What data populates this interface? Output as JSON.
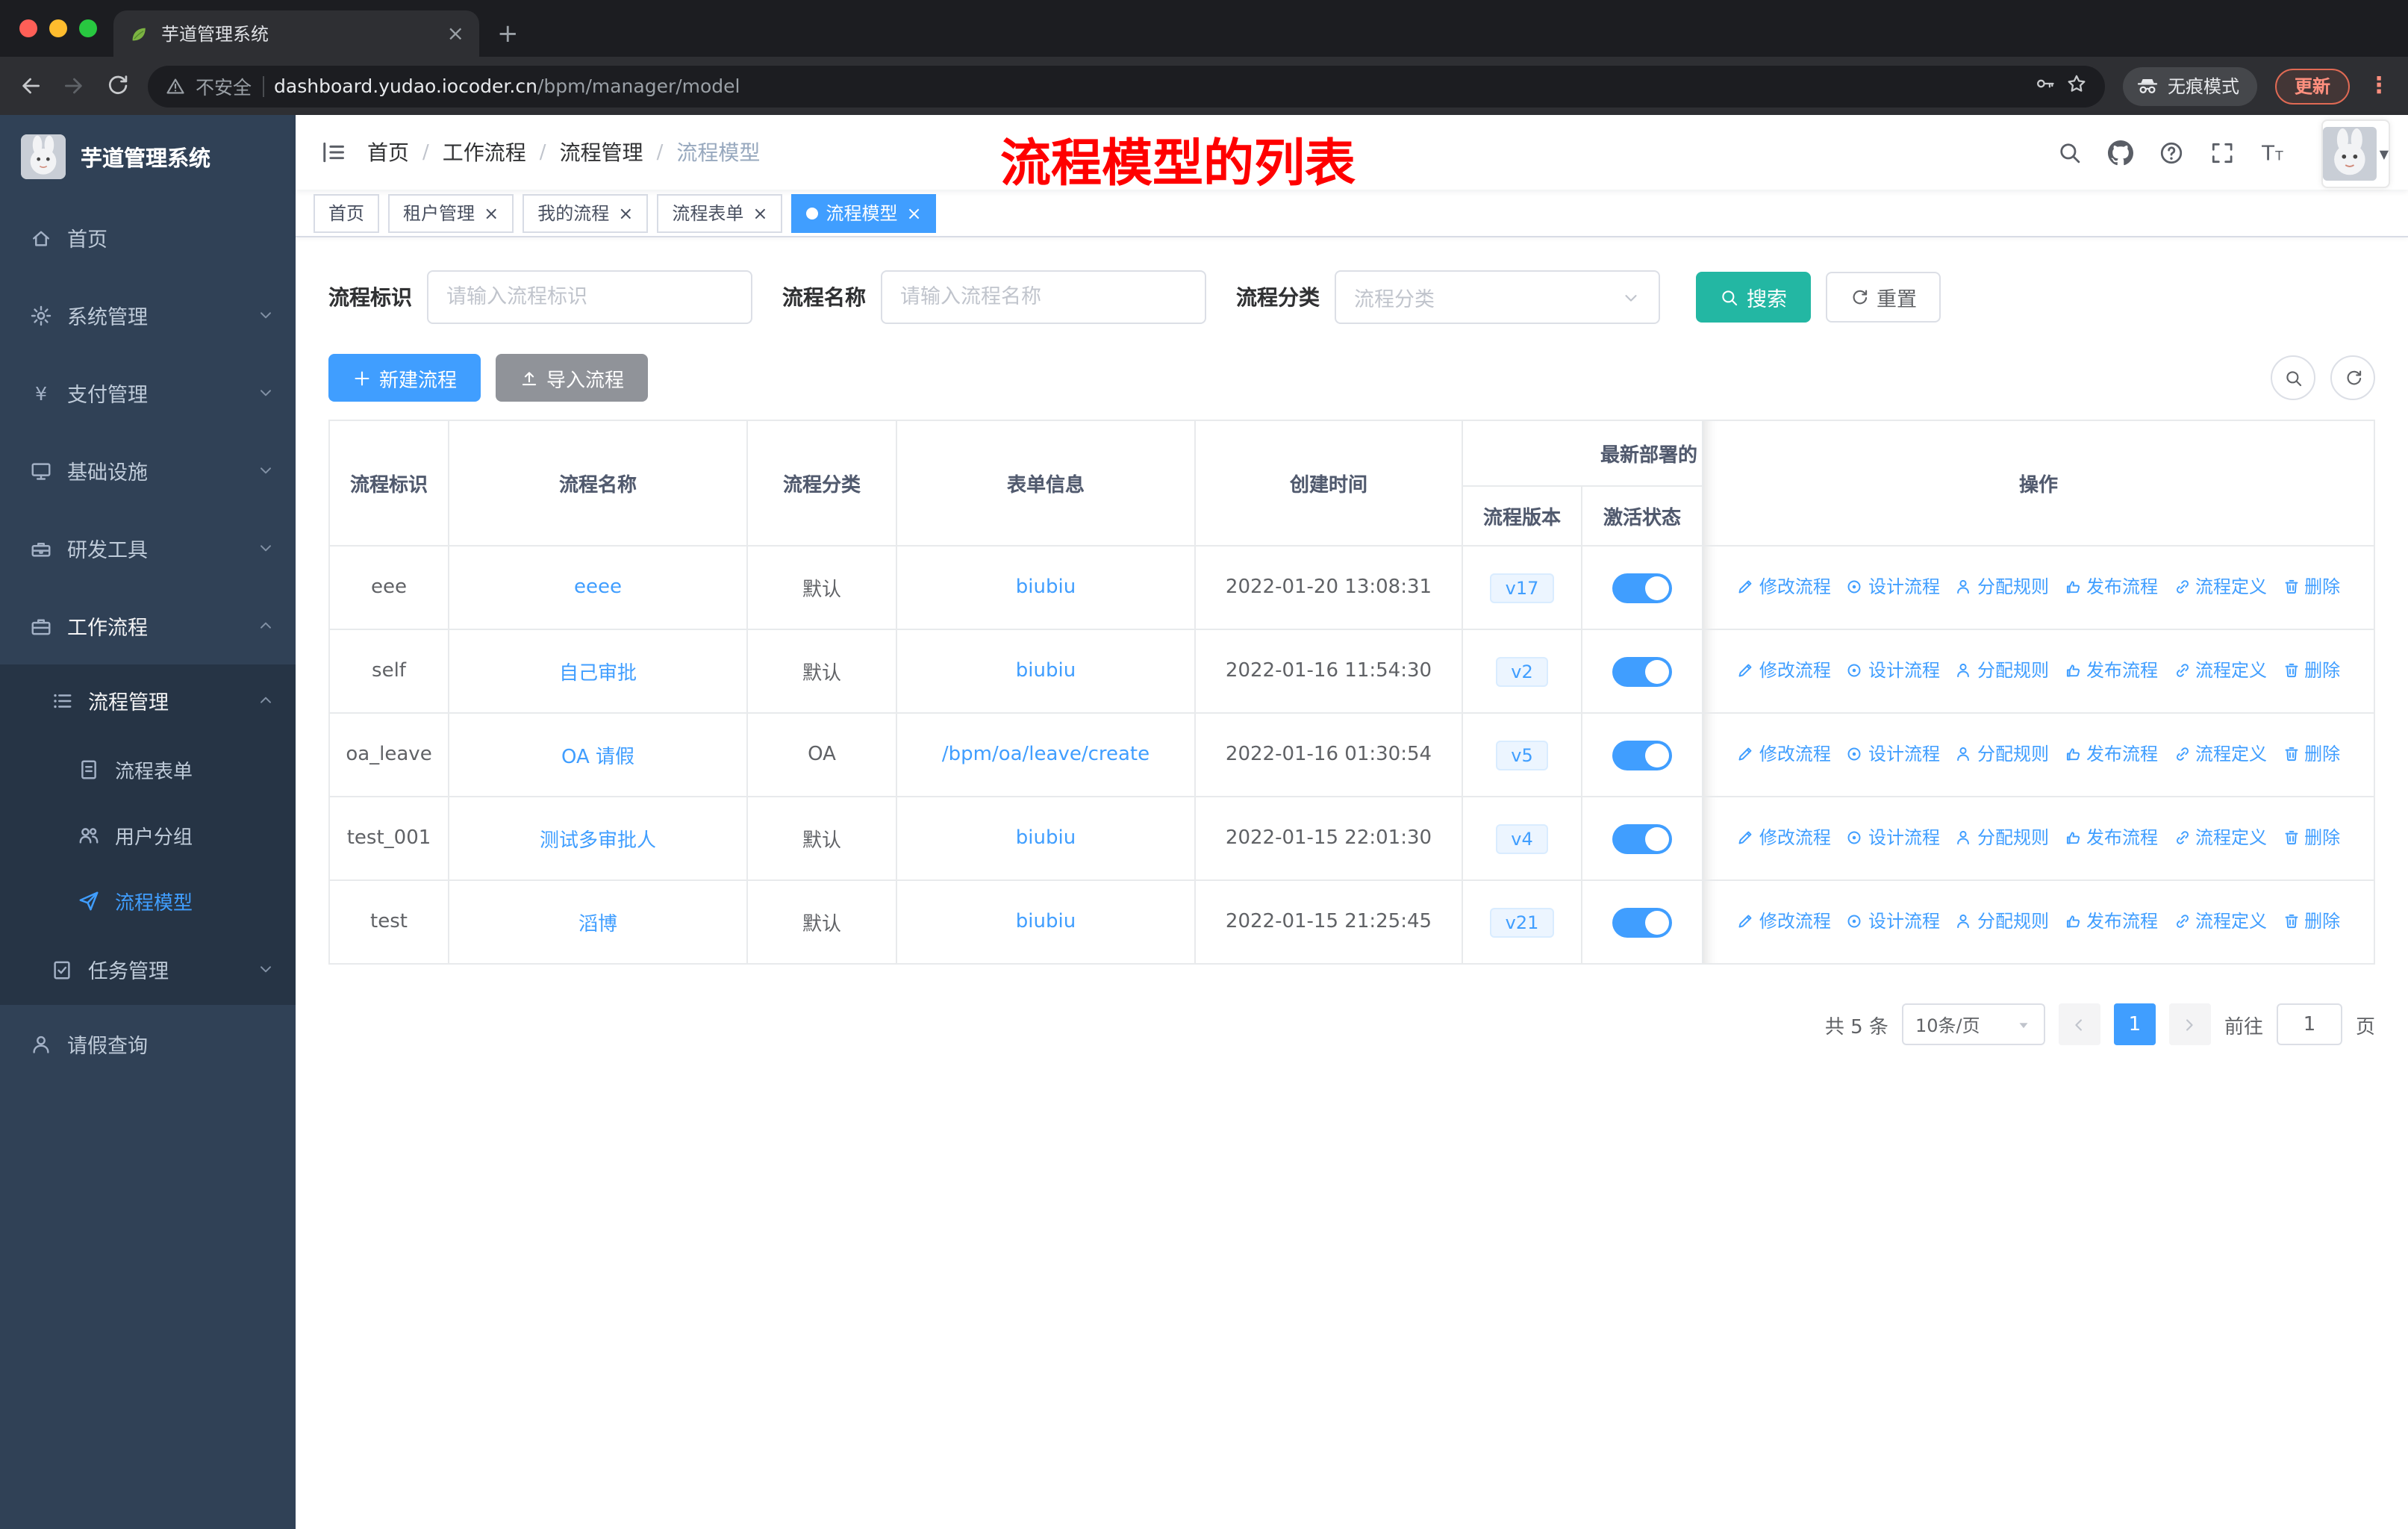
{
  "colors": {
    "accent_blue": "#409eff",
    "search_button_teal": "#23b7a3",
    "annotation_red": "#ff0000",
    "sidebar_bg": "#304156",
    "tag_active_blue": "#409eff"
  },
  "browser": {
    "tab_title": "芋道管理系统",
    "security_label": "不安全",
    "url_host": "dashboard.yudao.iocoder.cn",
    "url_path": "/bpm/manager/model",
    "incognito_label": "无痕模式",
    "update_label": "更新"
  },
  "sidebar": {
    "logo_title": "芋道管理系统",
    "items": [
      {
        "key": "home",
        "label": "首页",
        "icon": "home-icon",
        "level": 1
      },
      {
        "key": "system",
        "label": "系统管理",
        "icon": "gear-icon",
        "level": 1,
        "chevron": "down"
      },
      {
        "key": "payment",
        "label": "支付管理",
        "icon": "yen-icon",
        "level": 1,
        "chevron": "down"
      },
      {
        "key": "infrastructure",
        "label": "基础设施",
        "icon": "infra-icon",
        "level": 1,
        "chevron": "down"
      },
      {
        "key": "devtools",
        "label": "研发工具",
        "icon": "tools-icon",
        "level": 1,
        "chevron": "down"
      },
      {
        "key": "workflow",
        "label": "工作流程",
        "icon": "workflow-icon",
        "level": 1,
        "chevron": "up",
        "open": true
      },
      {
        "key": "process-manage",
        "label": "流程管理",
        "icon": "process-list-icon",
        "level": 2,
        "chevron": "up",
        "open": true
      },
      {
        "key": "process-form",
        "label": "流程表单",
        "icon": "form-icon",
        "level": 3
      },
      {
        "key": "user-group",
        "label": "用户分组",
        "icon": "users-icon",
        "level": 3
      },
      {
        "key": "process-model",
        "label": "流程模型",
        "icon": "send-icon",
        "level": 3,
        "active": true
      },
      {
        "key": "task-manage",
        "label": "任务管理",
        "icon": "task-icon",
        "level": 2,
        "chevron": "down"
      },
      {
        "key": "leave-query",
        "label": "请假查询",
        "icon": "user-icon",
        "level": 1
      }
    ]
  },
  "navbar": {
    "breadcrumb": [
      "首页",
      "工作流程",
      "流程管理",
      "流程模型"
    ],
    "annotation": "流程模型的列表"
  },
  "tags": [
    {
      "label": "首页",
      "closable": false,
      "active": false
    },
    {
      "label": "租户管理",
      "closable": true,
      "active": false
    },
    {
      "label": "我的流程",
      "closable": true,
      "active": false
    },
    {
      "label": "流程表单",
      "closable": true,
      "active": false
    },
    {
      "label": "流程模型",
      "closable": true,
      "active": true
    }
  ],
  "filters": {
    "id_label": "流程标识",
    "id_placeholder": "请输入流程标识",
    "name_label": "流程名称",
    "name_placeholder": "请输入流程名称",
    "category_label": "流程分类",
    "category_placeholder": "流程分类",
    "search_label": "搜索",
    "reset_label": "重置"
  },
  "toolbar": {
    "create_label": "新建流程",
    "import_label": "导入流程"
  },
  "table": {
    "headers": {
      "id": "流程标识",
      "name": "流程名称",
      "category": "流程分类",
      "form": "表单信息",
      "created": "创建时间",
      "deploy_group": "最新部署的",
      "version": "流程版本",
      "status": "激活状态",
      "ops": "操作"
    },
    "rows": [
      {
        "id": "eee",
        "name": "eeee",
        "category": "默认",
        "form": "biubiu",
        "created": "2022-01-20 13:08:31",
        "version": "v17",
        "active": true
      },
      {
        "id": "self",
        "name": "自己审批",
        "category": "默认",
        "form": "biubiu",
        "created": "2022-01-16 11:54:30",
        "version": "v2",
        "active": true
      },
      {
        "id": "oa_leave",
        "name": "OA 请假",
        "category": "OA",
        "form": "/bpm/oa/leave/create",
        "created": "2022-01-16 01:30:54",
        "version": "v5",
        "active": true
      },
      {
        "id": "test_001",
        "name": "测试多审批人",
        "category": "默认",
        "form": "biubiu",
        "created": "2022-01-15 22:01:30",
        "version": "v4",
        "active": true
      },
      {
        "id": "test",
        "name": "滔博",
        "category": "默认",
        "form": "biubiu",
        "created": "2022-01-15 21:25:45",
        "version": "v21",
        "active": true
      }
    ],
    "ops": [
      {
        "key": "edit",
        "label": "修改流程",
        "icon": "edit-icon"
      },
      {
        "key": "design",
        "label": "设计流程",
        "icon": "design-icon"
      },
      {
        "key": "assign",
        "label": "分配规则",
        "icon": "assign-icon"
      },
      {
        "key": "publish",
        "label": "发布流程",
        "icon": "publish-icon"
      },
      {
        "key": "definition",
        "label": "流程定义",
        "icon": "definition-icon"
      },
      {
        "key": "delete",
        "label": "删除",
        "icon": "delete-icon"
      }
    ]
  },
  "pagination": {
    "total_label": "共 5 条",
    "page_size_label": "10条/页",
    "current_page": "1",
    "goto_label": "前往",
    "goto_value": "1",
    "page_unit_label": "页"
  }
}
